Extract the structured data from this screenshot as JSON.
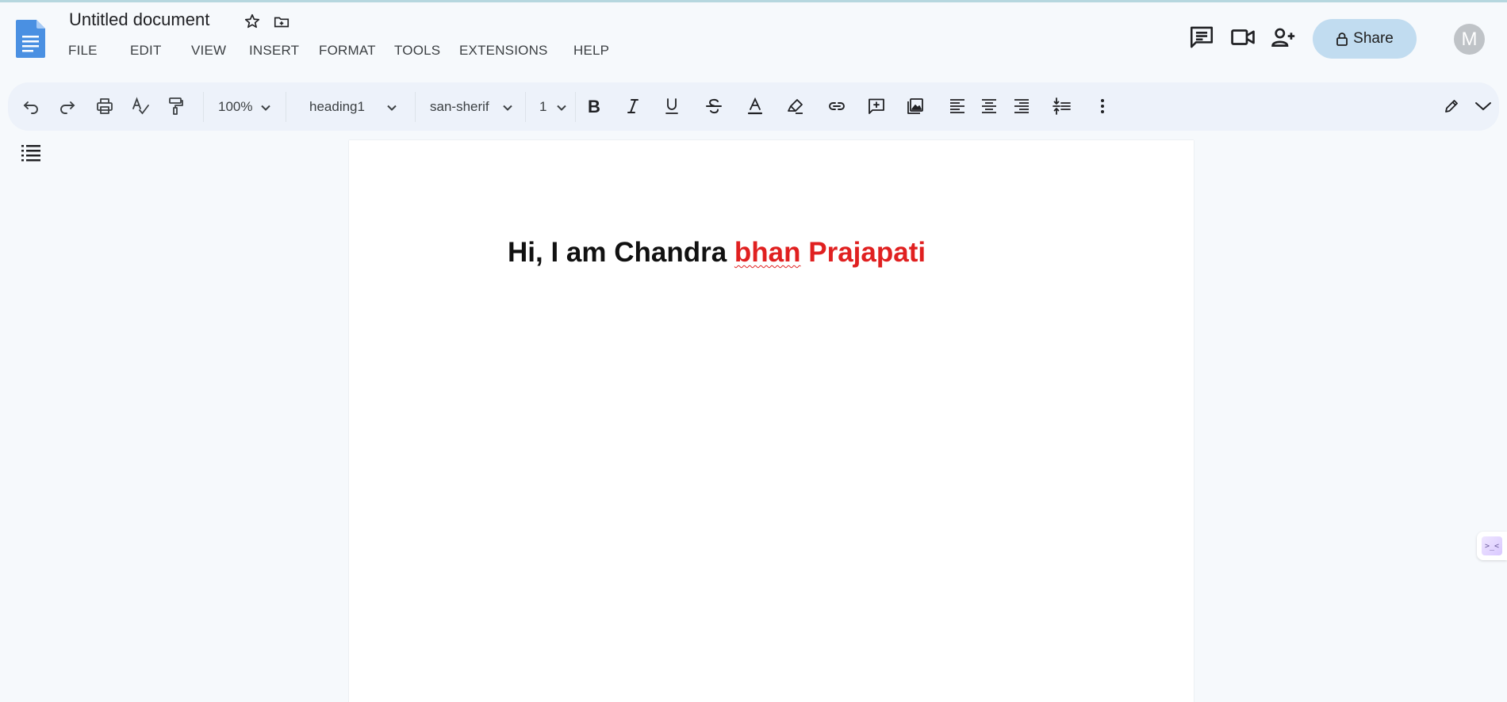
{
  "document": {
    "title": "Untitled document"
  },
  "menu": {
    "items": [
      "FILE",
      "EDIT",
      "VIEW",
      "INSERT",
      "FORMAT",
      "TOOLS",
      "EXTENSIONS",
      "HELP"
    ]
  },
  "header": {
    "share_label": "Share",
    "avatar_initial": "M",
    "icons": [
      "comments-icon",
      "video-call-icon",
      "add-person-icon",
      "lock-icon"
    ]
  },
  "toolbar": {
    "zoom": "100%",
    "style": "heading1",
    "font": "san-sherif",
    "font_size": "1",
    "icons": [
      "undo-icon",
      "redo-icon",
      "print-icon",
      "spellcheck-icon",
      "paint-format-icon",
      "bold-icon",
      "italic-icon",
      "underline-icon",
      "strikethrough-icon",
      "text-color-icon",
      "highlight-icon",
      "link-icon",
      "add-comment-icon",
      "insert-image-icon",
      "align-left-icon",
      "align-center-icon",
      "align-right-icon",
      "line-spacing-icon",
      "more-icon",
      "edit-mode-icon",
      "collapse-icon"
    ]
  },
  "content": {
    "heading_black": "Hi, I am Chandra ",
    "heading_misspelled": "bhan",
    "heading_red": " Prajapati"
  },
  "colors": {
    "accent_share": "#c1dcf0",
    "heading_red": "#e02020",
    "doc_icon_blue": "#4a90e2"
  },
  "widget": {
    "label": ">_<"
  }
}
